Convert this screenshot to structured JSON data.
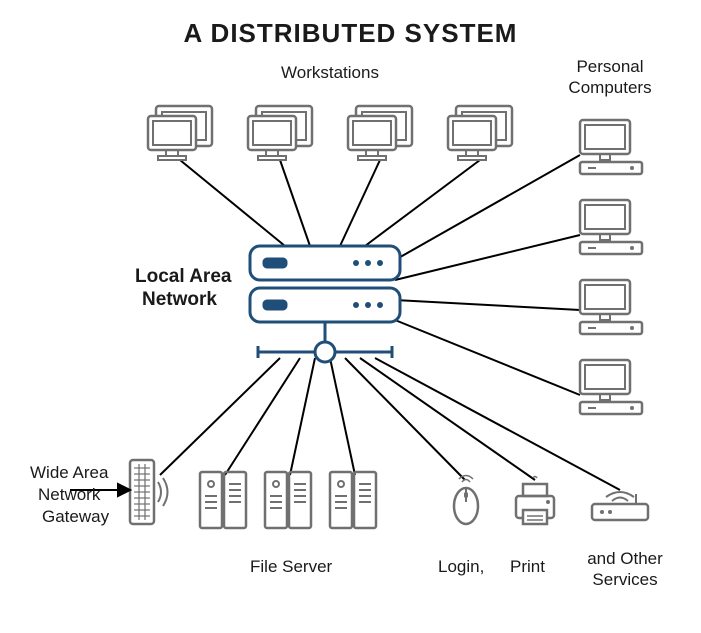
{
  "title": "A DISTRIBUTED SYSTEM",
  "labels": {
    "workstations": "Workstations",
    "personal_computers": "Personal\nComputers",
    "lan_line1": "Local Area",
    "lan_line2": "Network",
    "wan_line1": "Wide Area",
    "wan_line2": "Network",
    "wan_line3": "Gateway",
    "file_server": "File Server",
    "login": "Login,",
    "print": "Print",
    "other": "and Other\nServices"
  },
  "nodes": {
    "workstations": 4,
    "personal_computers": 4,
    "file_servers": 3,
    "lan_hub": 1,
    "wan_gateway": 1,
    "login_mouse": 1,
    "printer": 1,
    "router": 1
  },
  "colors": {
    "hub": "#1f4e79",
    "device": "#707070"
  }
}
